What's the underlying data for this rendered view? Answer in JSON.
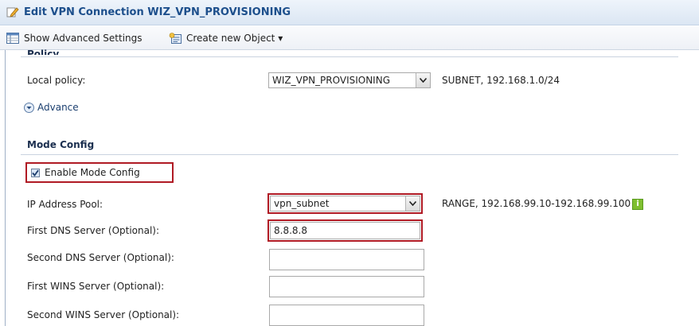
{
  "window": {
    "title": "Edit VPN Connection WIZ_VPN_PROVISIONING"
  },
  "toolbar": {
    "show_advanced_label": "Show Advanced Settings",
    "create_object_label": "Create new Object ▾"
  },
  "policy": {
    "section_title": "Policy",
    "local_policy_label": "Local policy:",
    "local_policy_value": "WIZ_VPN_PROVISIONING",
    "local_policy_note": "SUBNET, 192.168.1.0/24",
    "advance_label": "Advance"
  },
  "mode_config": {
    "section_title": "Mode Config",
    "enable_label": "Enable Mode Config",
    "enable_checked": true,
    "ip_pool_label": "IP Address Pool:",
    "ip_pool_value": "vpn_subnet",
    "ip_pool_note": "RANGE, 192.168.99.10-192.168.99.100",
    "first_dns_label": "First DNS Server (Optional):",
    "first_dns_value": "8.8.8.8",
    "second_dns_label": "Second DNS Server (Optional):",
    "second_dns_value": "",
    "first_wins_label": "First WINS Server (Optional):",
    "first_wins_value": "",
    "second_wins_label": "Second WINS Server (Optional):",
    "second_wins_value": ""
  },
  "colors": {
    "highlight": "#b01a24",
    "title_text": "#1d4f8c",
    "info_icon": "#7fbf2f"
  }
}
